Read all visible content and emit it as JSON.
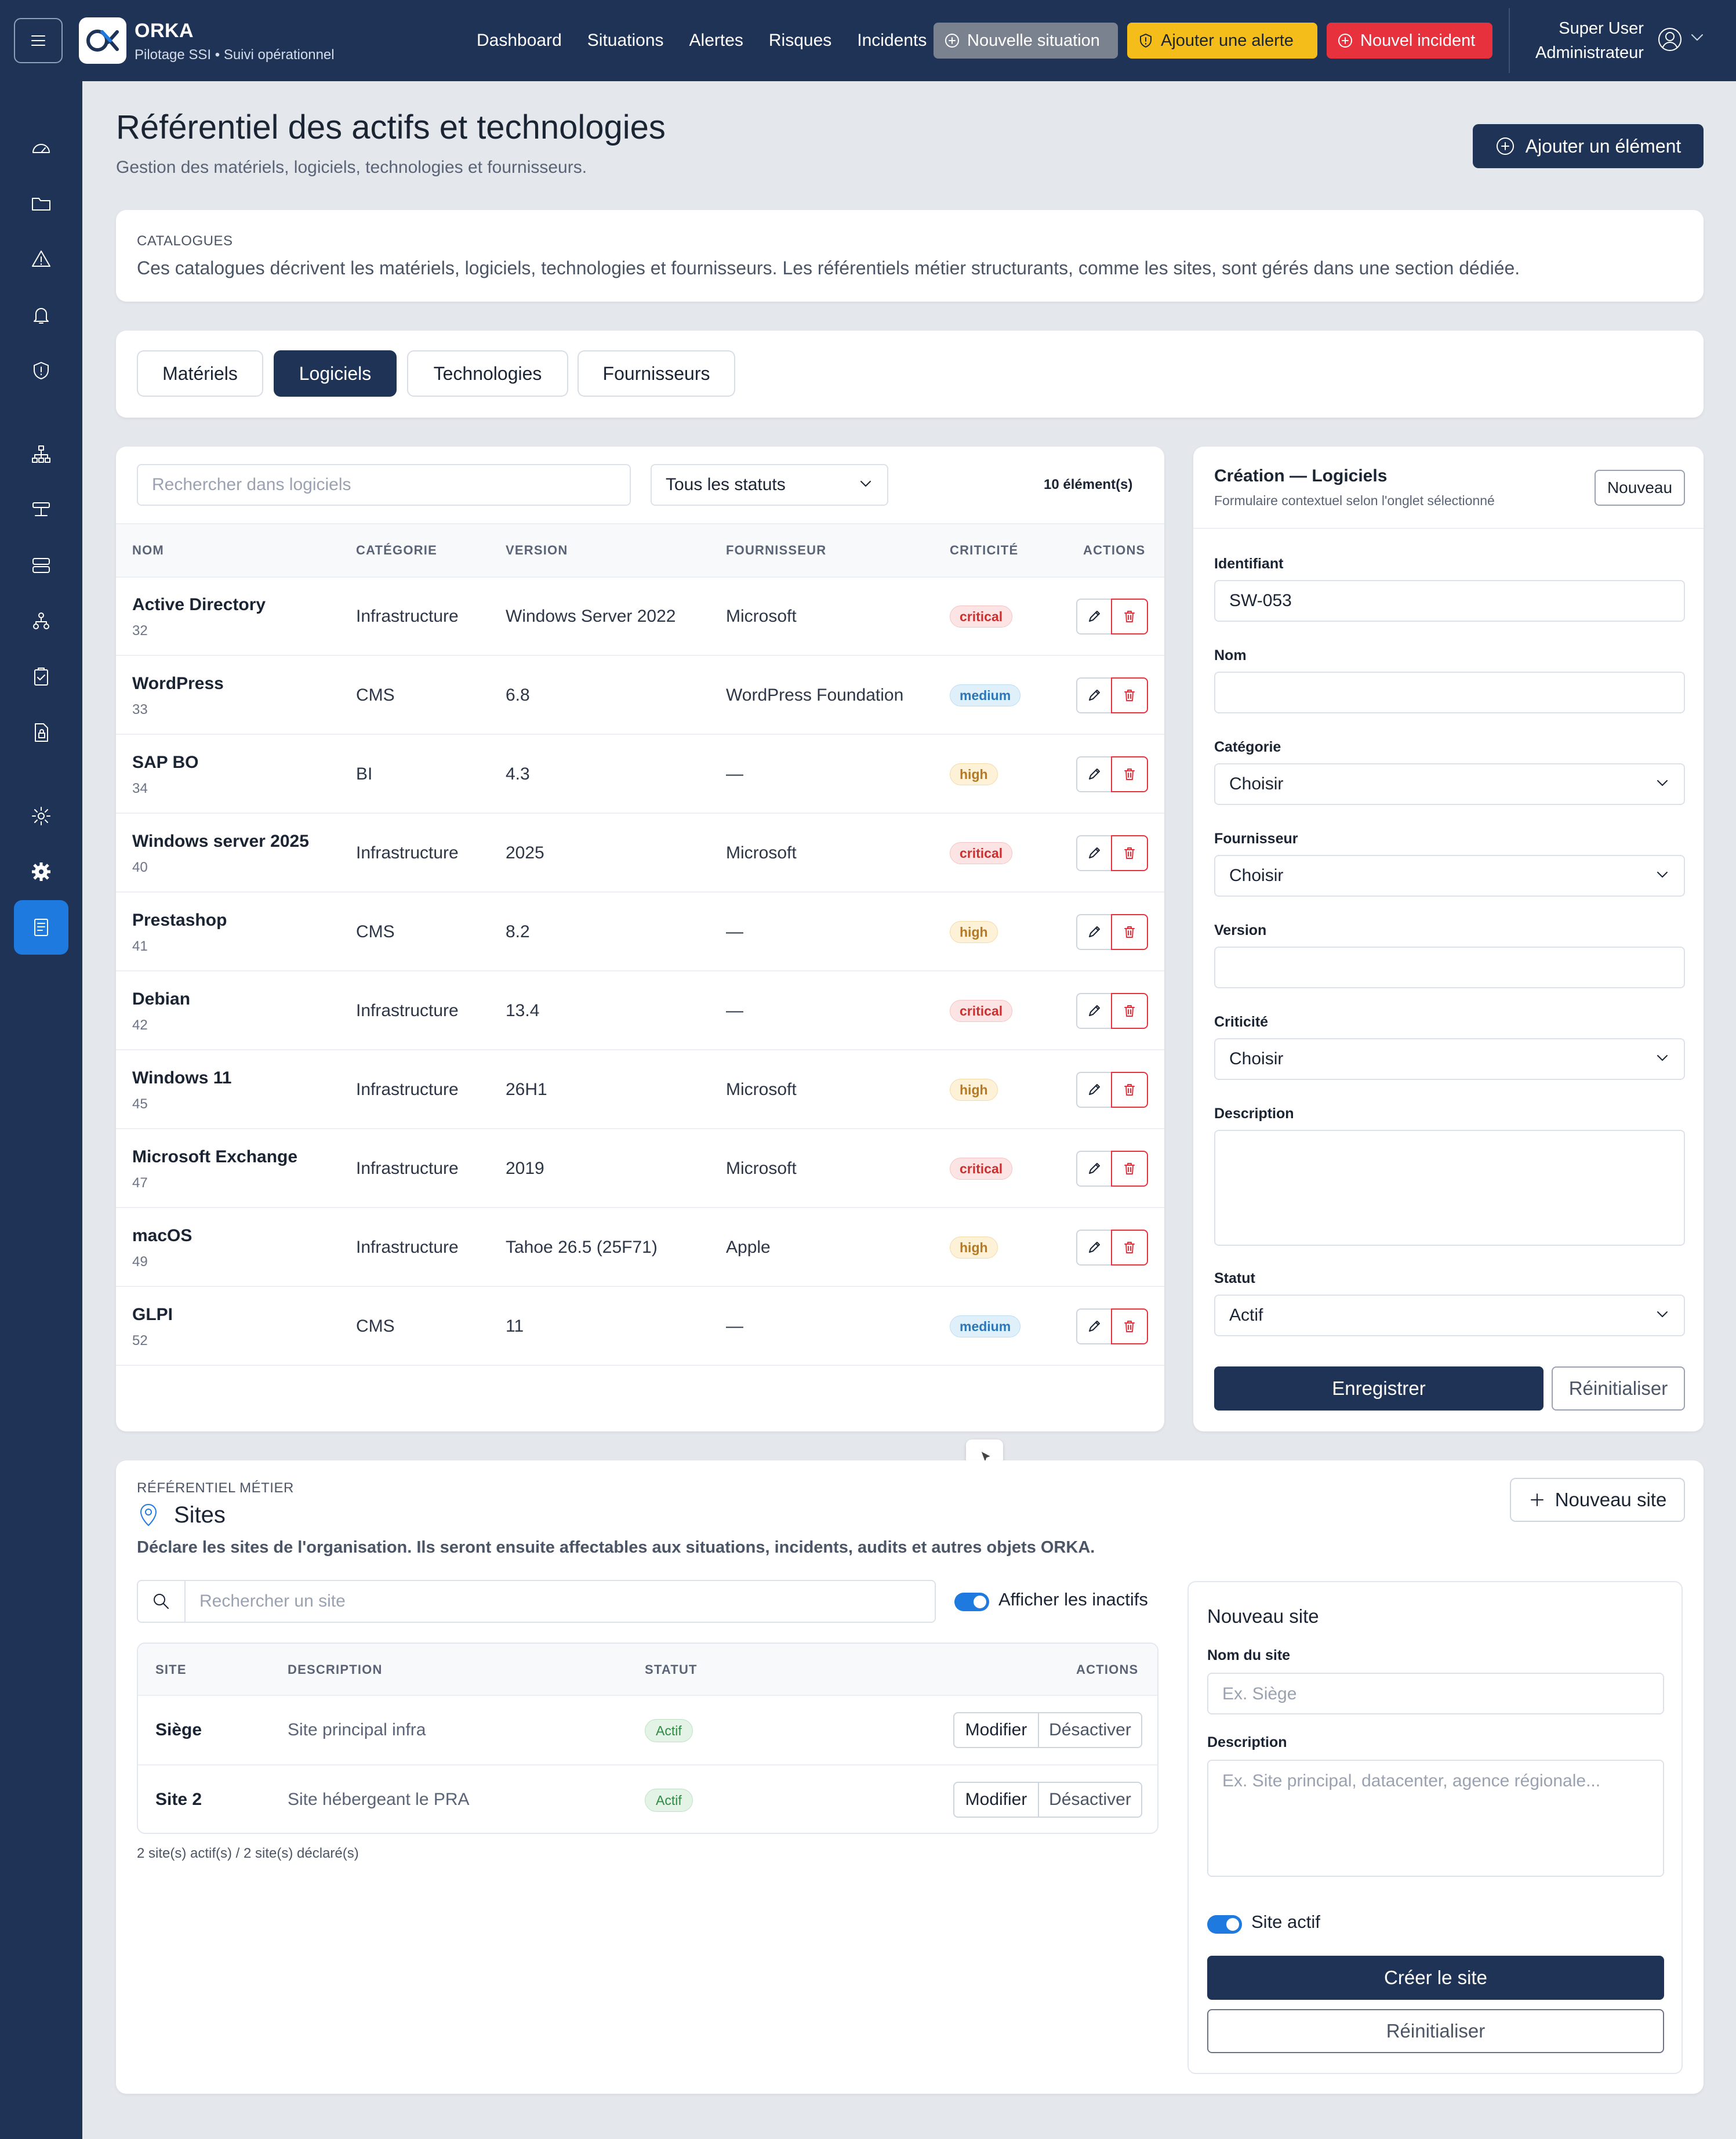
{
  "app": {
    "name": "ORKA",
    "subtitle": "Pilotage SSI • Suivi opérationnel"
  },
  "nav": [
    "Dashboard",
    "Situations",
    "Alertes",
    "Risques",
    "Incidents"
  ],
  "actions": {
    "new_situation": "Nouvelle situation",
    "add_alert": "Ajouter une alerte",
    "new_incident": "Nouvel incident"
  },
  "user": {
    "name": "Super User",
    "role": "Administrateur"
  },
  "colors": {
    "primary": "#1e3355",
    "accent": "#1f7ae0",
    "warning": "#f5bd19",
    "danger": "#e7323e"
  },
  "sidebar_icons": [
    "dashboard-icon",
    "folder-icon",
    "warning-icon",
    "bell-icon",
    "shield-icon",
    "sitemap-icon",
    "network-icon",
    "server-icon",
    "users-tree-icon",
    "clipboard-check-icon",
    "file-lock-icon",
    "settings-icon",
    "gear-icon",
    "catalog-icon"
  ],
  "page": {
    "title": "Référentiel des actifs et technologies",
    "subtitle": "Gestion des matériels, logiciels, technologies et fournisseurs.",
    "add_button": "Ajouter un élément"
  },
  "catalogues": {
    "label": "CATALOGUES",
    "text": "Ces catalogues décrivent les matériels, logiciels, technologies et fournisseurs. Les référentiels métier structurants, comme les sites, sont gérés dans une section dédiée."
  },
  "tabs": [
    {
      "label": "Matériels",
      "active": false
    },
    {
      "label": "Logiciels",
      "active": true
    },
    {
      "label": "Technologies",
      "active": false
    },
    {
      "label": "Fournisseurs",
      "active": false
    }
  ],
  "software": {
    "search_placeholder": "Rechercher dans logiciels",
    "status_filter": "Tous les statuts",
    "count": "10 élément(s)",
    "columns": [
      "NOM",
      "CATÉGORIE",
      "VERSION",
      "FOURNISSEUR",
      "CRITICITÉ",
      "ACTIONS"
    ],
    "rows": [
      {
        "name": "Active Directory",
        "id": "32",
        "category": "Infrastructure",
        "version": "Windows Server 2022",
        "vendor": "Microsoft",
        "criticality": "critical"
      },
      {
        "name": "WordPress",
        "id": "33",
        "category": "CMS",
        "version": "6.8",
        "vendor": "WordPress Foundation",
        "criticality": "medium"
      },
      {
        "name": "SAP BO",
        "id": "34",
        "category": "BI",
        "version": "4.3",
        "vendor": "—",
        "criticality": "high"
      },
      {
        "name": "Windows server 2025",
        "id": "40",
        "category": "Infrastructure",
        "version": "2025",
        "vendor": "Microsoft",
        "criticality": "critical"
      },
      {
        "name": "Prestashop",
        "id": "41",
        "category": "CMS",
        "version": "8.2",
        "vendor": "—",
        "criticality": "high"
      },
      {
        "name": "Debian",
        "id": "42",
        "category": "Infrastructure",
        "version": "13.4",
        "vendor": "—",
        "criticality": "critical"
      },
      {
        "name": "Windows 11",
        "id": "45",
        "category": "Infrastructure",
        "version": "26H1",
        "vendor": "Microsoft",
        "criticality": "high"
      },
      {
        "name": "Microsoft Exchange",
        "id": "47",
        "category": "Infrastructure",
        "version": "2019",
        "vendor": "Microsoft",
        "criticality": "critical"
      },
      {
        "name": "macOS",
        "id": "49",
        "category": "Infrastructure",
        "version": "Tahoe 26.5 (25F71)",
        "vendor": "Apple",
        "criticality": "high"
      },
      {
        "name": "GLPI",
        "id": "52",
        "category": "CMS",
        "version": "11",
        "vendor": "—",
        "criticality": "medium"
      }
    ]
  },
  "form": {
    "title": "Création — Logiciels",
    "subtitle": "Formulaire contextuel selon l'onglet sélectionné",
    "new_button": "Nouveau",
    "id_label": "Identifiant",
    "id_value": "SW-053",
    "name_label": "Nom",
    "name_value": "",
    "category_label": "Catégorie",
    "category_value": "Choisir",
    "vendor_label": "Fournisseur",
    "vendor_value": "Choisir",
    "version_label": "Version",
    "version_value": "",
    "criticality_label": "Criticité",
    "criticality_value": "Choisir",
    "description_label": "Description",
    "description_value": "",
    "status_label": "Statut",
    "status_value": "Actif",
    "save": "Enregistrer",
    "reset": "Réinitialiser"
  },
  "sites": {
    "label": "RÉFÉRENTIEL MÉTIER",
    "title": "Sites",
    "description": "Déclare les sites de l'organisation. Ils seront ensuite affectables aux situations, incidents, audits et autres objets ORKA.",
    "new_button": "Nouveau site",
    "search_placeholder": "Rechercher un site",
    "show_inactive": "Afficher les inactifs",
    "columns": [
      "SITE",
      "DESCRIPTION",
      "STATUT",
      "ACTIONS"
    ],
    "rows": [
      {
        "name": "Siège",
        "description": "Site principal infra",
        "status": "Actif",
        "edit": "Modifier",
        "deactivate": "Désactiver"
      },
      {
        "name": "Site 2",
        "description": "Site hébergeant le PRA",
        "status": "Actif",
        "edit": "Modifier",
        "deactivate": "Désactiver"
      }
    ],
    "footer": "2 site(s) actif(s) / 2 site(s) déclaré(s)",
    "new_form": {
      "title": "Nouveau site",
      "name_label": "Nom du site",
      "name_placeholder": "Ex. Siège",
      "description_label": "Description",
      "description_placeholder": "Ex. Site principal, datacenter, agence régionale...",
      "active_label": "Site actif",
      "create": "Créer le site",
      "reset": "Réinitialiser"
    }
  }
}
